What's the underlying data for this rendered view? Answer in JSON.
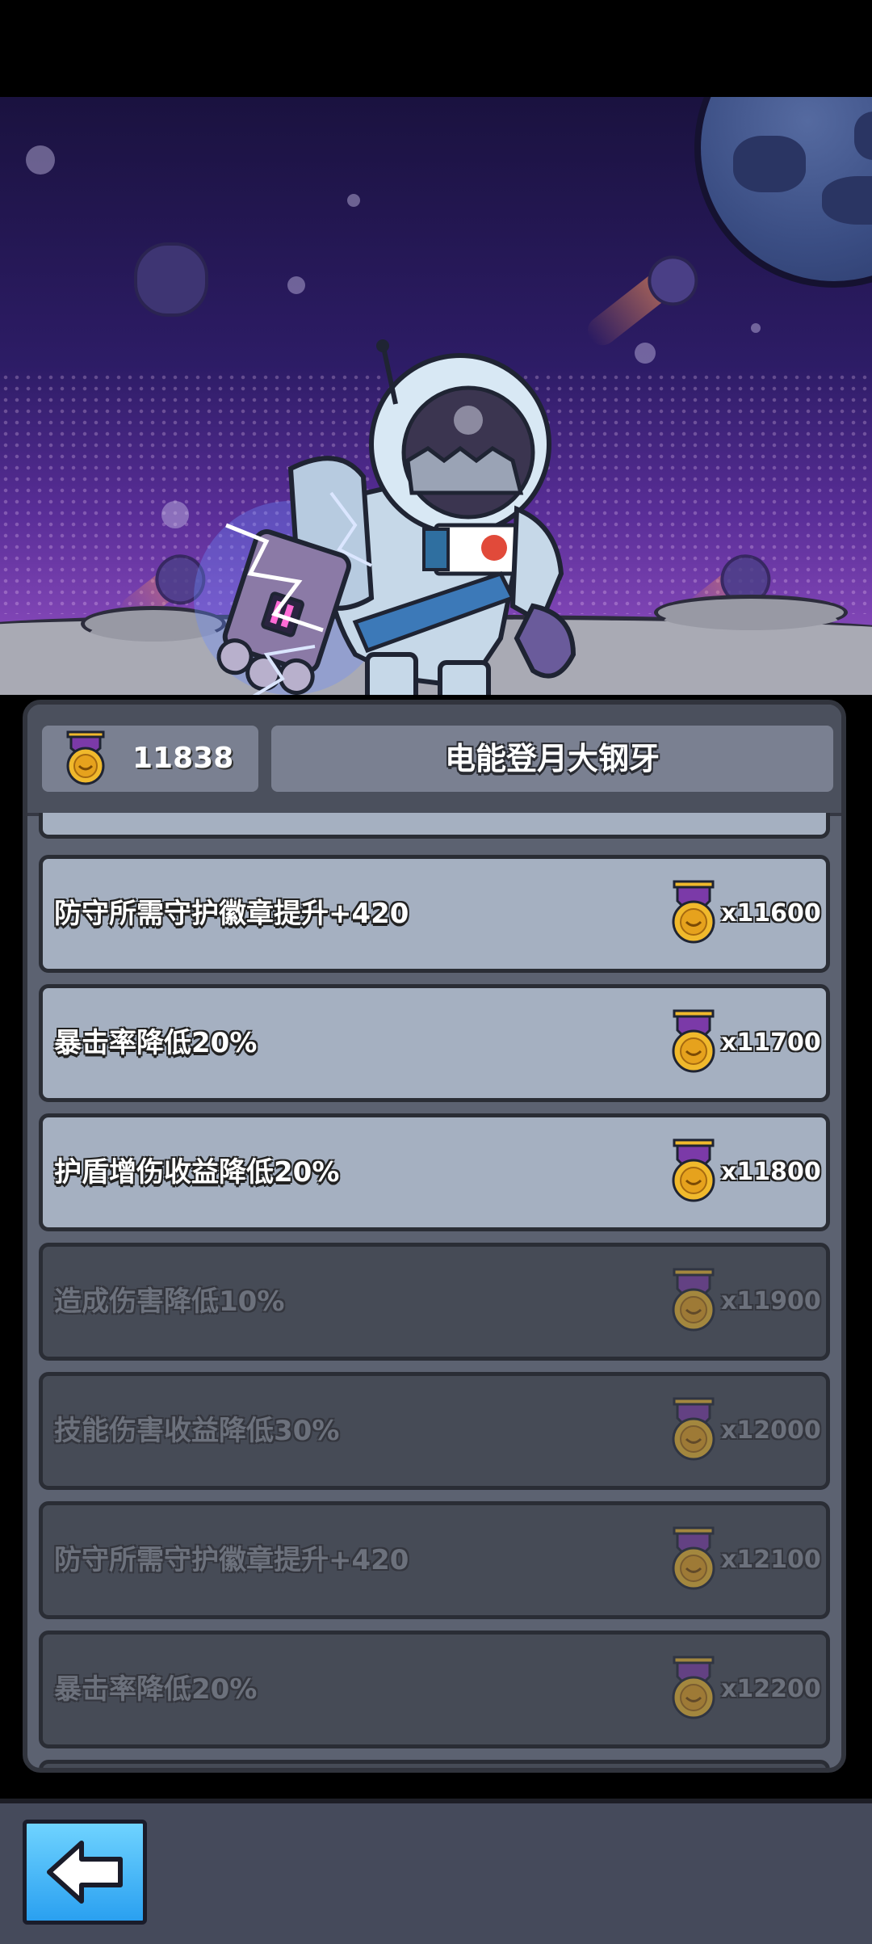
{
  "header": {
    "badge_count": "11838",
    "title": "电能登月大钢牙"
  },
  "upgrades": [
    {
      "label": "防守所需守护徽章提升+420",
      "cost": "x11600",
      "state": "unlocked"
    },
    {
      "label": "暴击率降低20%",
      "cost": "x11700",
      "state": "unlocked"
    },
    {
      "label": "护盾增伤收益降低20%",
      "cost": "x11800",
      "state": "unlocked"
    },
    {
      "label": "造成伤害降低10%",
      "cost": "x11900",
      "state": "locked"
    },
    {
      "label": "技能伤害收益降低30%",
      "cost": "x12000",
      "state": "locked"
    },
    {
      "label": "防守所需守护徽章提升+420",
      "cost": "x12100",
      "state": "locked"
    },
    {
      "label": "暴击率降低20%",
      "cost": "x12200",
      "state": "locked"
    }
  ],
  "colors": {
    "unlocked_row": "#a5b0c1",
    "locked_row": "#464b56",
    "medal_gold": "#f0b92c",
    "ribbon_purple": "#7b3aa8",
    "back_button": "#2aa0f0"
  },
  "icons": {
    "medal": "guardian-medal-icon",
    "back": "back-arrow-icon"
  }
}
